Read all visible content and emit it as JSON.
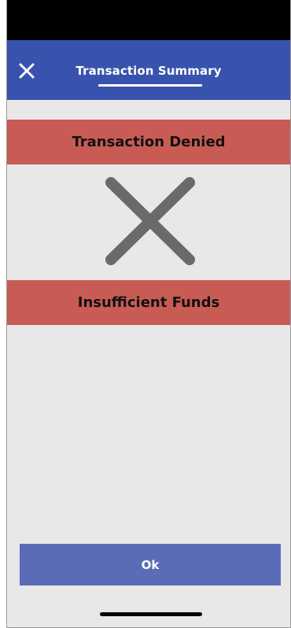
{
  "header": {
    "title": "Transaction Summary",
    "close_icon": "close-icon"
  },
  "status": {
    "title": "Transaction Denied",
    "icon": "denied-x-icon",
    "reason": "Insufficient Funds"
  },
  "actions": {
    "ok_label": "Ok"
  },
  "colors": {
    "header_bg": "#3853ad",
    "banner_bg": "#c85c55",
    "button_bg": "#5a6cb8",
    "page_bg": "#e8e8e9",
    "icon_gray": "#6a6a6a"
  }
}
